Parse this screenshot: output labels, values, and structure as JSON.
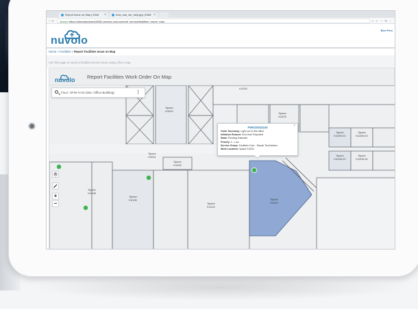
{
  "browser": {
    "tabs": [
      {
        "title": "Report Issue on Map | EAM"
      },
      {
        "title": "how_can_we_help.jpg | EAM"
      }
    ],
    "nav": "‹ ›  C",
    "secure_label": "Secure",
    "url": "https://storeappdemo00051.service-now.com/nef_service/facilities_report_map",
    "right_icons": "☆ ◐ ⋯ ⊡ ⋮"
  },
  "app": {
    "logo_text": "nuvolo",
    "user": "Ben Pers",
    "breadcrumb": {
      "home": "Home",
      "sep1": " > ",
      "facilities": "Facilities",
      "sep2": " > ",
      "current": "Report Facilities Issue on Map"
    },
    "hint": "Use this page to report a facilities device issue using a floor map."
  },
  "panel": {
    "logo_text": "nuvolo",
    "title": "Report Facilities Work Order On Map",
    "search_value": "Floor: OFW-H-03 (Site: Office Building)",
    "kebab": "⋮",
    "zoom_in": "+",
    "zoom_out": "−"
  },
  "rooms": [
    {
      "id": "r1",
      "line1": "Space",
      "line2": "K4010"
    },
    {
      "id": "r2",
      "line1": "Space",
      "line2": "K4011"
    },
    {
      "id": "r3",
      "line1": "Space",
      "line2": "K4100"
    },
    {
      "id": "r4",
      "line1": "Space",
      "line2": "K4108"
    },
    {
      "id": "r5",
      "line1": "Space",
      "line2": "K4106"
    },
    {
      "id": "r6",
      "line1": "Space",
      "line2": "K4104"
    },
    {
      "id": "r7",
      "line1": "Space",
      "line2": "K4202"
    },
    {
      "id": "r8",
      "line1": "Space",
      "line2": "K4206.01"
    },
    {
      "id": "r9",
      "line1": "Space",
      "line2": "K4206.03"
    },
    {
      "id": "r10",
      "line1": "Space",
      "line2": "K4206.02"
    },
    {
      "id": "r11",
      "line1": "Space",
      "line2": "K4206.04"
    },
    {
      "id": "r12",
      "line1": "Space",
      "line2": "K4203"
    },
    {
      "id": "r13",
      "line1": "",
      "line2": "K4100"
    }
  ],
  "popup": {
    "id": "FWKO0010100",
    "close": "×",
    "fields": [
      {
        "label": "Order Summary:",
        "value": " Light out in this office"
      },
      {
        "label": "Initiation Reason:",
        "value": " End User Reported"
      },
      {
        "label": "State:",
        "value": " Pending Estimate"
      },
      {
        "label": "Priority:",
        "value": " 4 - Low"
      },
      {
        "label": "Service Group:",
        "value": " Facilities Core - Repair Technicians"
      },
      {
        "label": "Work Location:",
        "value": " Space K4202"
      }
    ]
  },
  "colors": {
    "brand": "#2e7cab",
    "selected_room": "#8fa8d4",
    "marker": "#3fb34f"
  }
}
